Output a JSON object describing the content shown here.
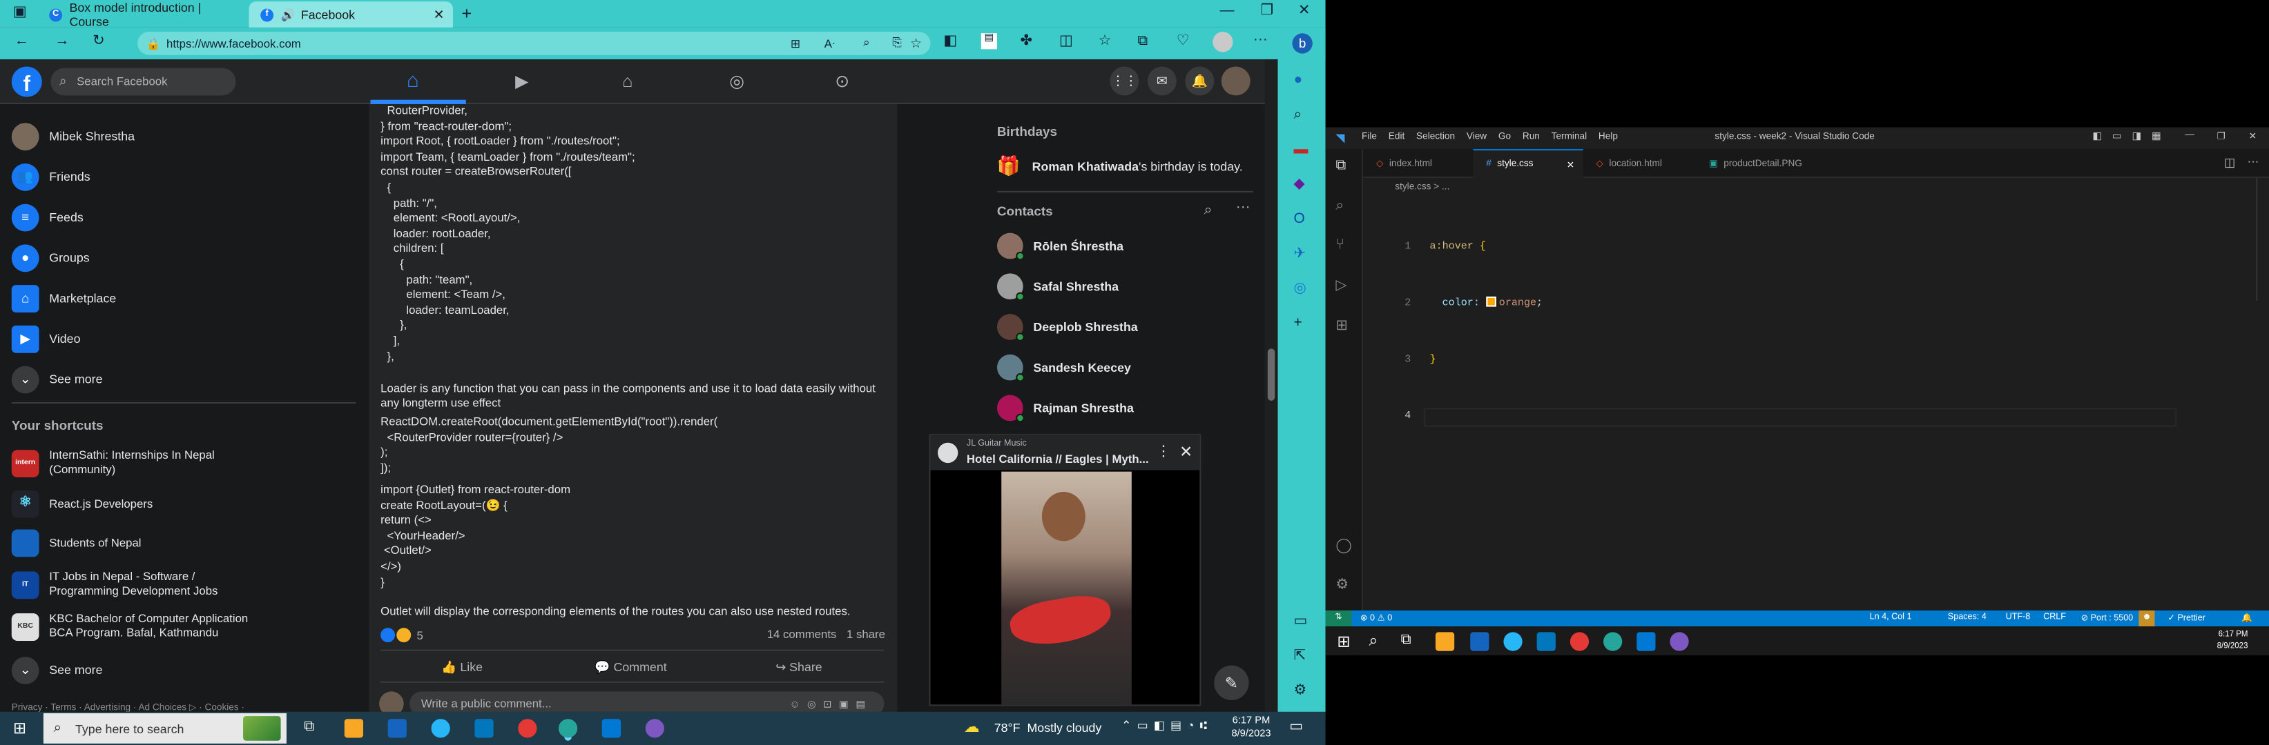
{
  "browser": {
    "tabs": [
      {
        "title": "Box model introduction | Course",
        "active": false
      },
      {
        "title": "Facebook",
        "active": true
      }
    ],
    "url": "https://www.facebook.com"
  },
  "facebook": {
    "search_placeholder": "Search Facebook",
    "left_nav": [
      {
        "label": "Mibek Shrestha",
        "icon": "avatar"
      },
      {
        "label": "Friends",
        "icon": "friends-icon"
      },
      {
        "label": "Feeds",
        "icon": "feeds-icon"
      },
      {
        "label": "Groups",
        "icon": "groups-icon"
      },
      {
        "label": "Marketplace",
        "icon": "marketplace-icon"
      },
      {
        "label": "Video",
        "icon": "video-icon"
      },
      {
        "label": "See more",
        "icon": "chevron-down-icon"
      }
    ],
    "shortcuts_title": "Your shortcuts",
    "shortcuts": [
      {
        "line1": "InternSathi: Internships In Nepal",
        "line2": "(Community)"
      },
      {
        "line1": "React.js Developers",
        "line2": ""
      },
      {
        "line1": "Students of Nepal",
        "line2": ""
      },
      {
        "line1": "IT Jobs in Nepal - Software /",
        "line2": "Programming Development Jobs"
      },
      {
        "line1": "KBC Bachelor of Computer Application",
        "line2": "BCA Program. Bafal, Kathmandu"
      }
    ],
    "see_more_2": "See more",
    "footer": "Privacy · Terms · Advertising · Ad Choices ▷ · Cookies ·",
    "post_lines": [
      "  RouterProvider,",
      "} from \"react-router-dom\";",
      "import Root, { rootLoader } from \"./routes/root\";",
      "import Team, { teamLoader } from \"./routes/team\";",
      "const router = createBrowserRouter([",
      "  {",
      "    path: \"/\",",
      "    element: <RootLayout/>,",
      "    loader: rootLoader,",
      "    children: [",
      "      {",
      "        path: \"team\",",
      "        element: <Team />,",
      "        loader: teamLoader,",
      "      },",
      "    ],",
      "  },"
    ],
    "post_para1a": "Loader is any function that you can pass in the components and use it to load data easily without",
    "post_para1b": "any longterm use effect",
    "post_lines2": [
      "ReactDOM.createRoot(document.getElementById(\"root\")).render(",
      "  <RouterProvider router={router} />",
      ");",
      "]);"
    ],
    "post_lines3": [
      "import {Outlet} from react-router-dom",
      "create RootLayout=(😉 {",
      "return (<>",
      "  <YourHeader/>",
      " <Outlet/>",
      "</>)",
      "}"
    ],
    "post_para2": "Outlet will display the corresponding elements of the routes you can also use nested routes.",
    "reactions_count": "5",
    "comments": "14 comments",
    "shares": "1 share",
    "actions": {
      "like": "Like",
      "comment": "Comment",
      "share": "Share"
    },
    "comment_placeholder": "Write a public comment...",
    "birthdays_title": "Birthdays",
    "birthday_name": "Roman Khatiwada",
    "birthday_text": "'s birthday is today.",
    "contacts_title": "Contacts",
    "contacts": [
      "Rōlen Śhrestha",
      "Safal Shrestha",
      "Deeplob Shrestha",
      "Sandesh Keecey",
      "Rajman Shrestha"
    ],
    "video": {
      "channel": "JL Guitar Music",
      "title": "Hotel California // Eagles | Myth..."
    }
  },
  "taskbar": {
    "search_placeholder": "Type here to search",
    "weather": "78°F  Mostly cloudy",
    "time": "6:17 PM",
    "date": "8/9/2023"
  },
  "vscode": {
    "menu": [
      "File",
      "Edit",
      "Selection",
      "View",
      "Go",
      "Run",
      "Terminal",
      "Help"
    ],
    "title": "style.css - week2 - Visual Studio Code",
    "tabs": [
      "index.html",
      "style.css",
      "location.html",
      "productDetail.PNG"
    ],
    "breadcrumb": "style.css > ...",
    "code": [
      {
        "n": "1",
        "sel": "a:hover",
        "rest": " {"
      },
      {
        "n": "2",
        "prop": "  color: ",
        "val": "orange",
        "end": ";"
      },
      {
        "n": "3",
        "text": "}"
      },
      {
        "n": "4",
        "text": ""
      }
    ],
    "status": {
      "errors": "⊗ 0 ⚠ 0",
      "position": "Ln 4, Col 1",
      "spaces": "Spaces: 4",
      "encoding": "UTF-8",
      "eol": "CRLF",
      "port": "Port : 5500",
      "prettier": "✓ Prettier"
    },
    "time": "6:17 PM",
    "date": "8/9/2023"
  },
  "colors": {
    "edge_accent": "#3ccbc9",
    "fb_blue": "#1877f2",
    "vs_blue": "#007acc",
    "orange": "#ffa500"
  }
}
